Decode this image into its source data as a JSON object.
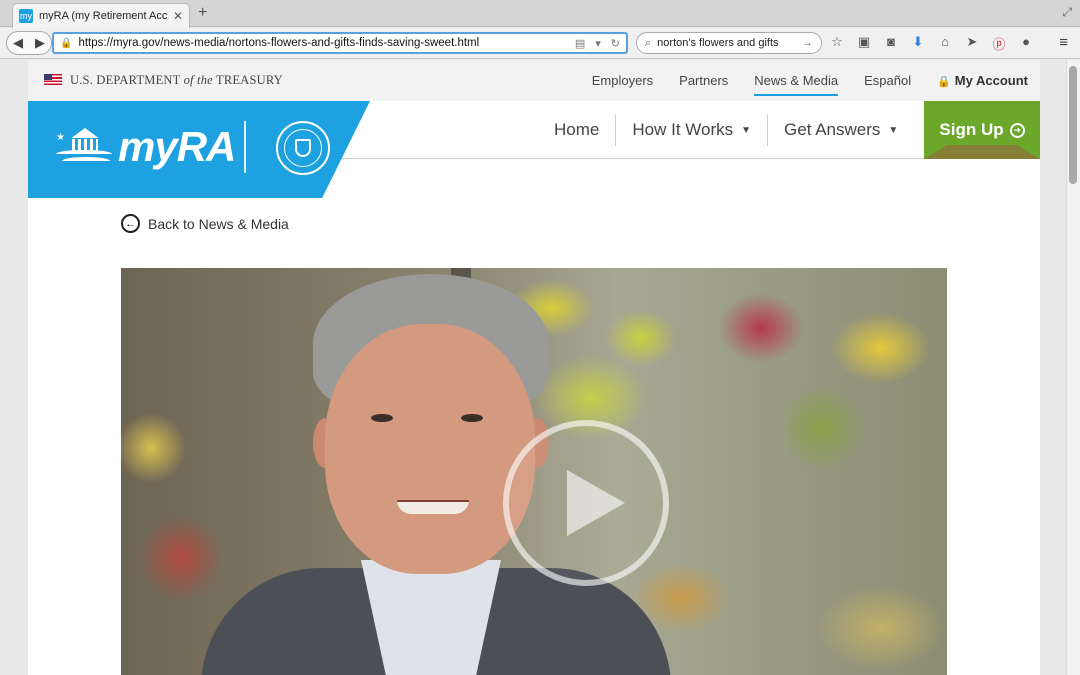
{
  "browser": {
    "tab": {
      "title": "myRA (my Retirement Acc…",
      "favicon_text": "my"
    },
    "url": "https://myra.gov/news-media/nortons-flowers-and-gifts-finds-saving-sweet.html",
    "search_query": "norton's flowers and gifts",
    "icons": [
      "star-icon",
      "reading-list-icon",
      "pocket-icon",
      "download-icon",
      "home-icon",
      "send-icon",
      "pinterest-icon",
      "chat-icon",
      "menu-icon"
    ]
  },
  "gov_bar": {
    "agency_prefix": "U.S. DEPARTMENT ",
    "agency_italic": "of the",
    "agency_suffix": " TREASURY",
    "links": {
      "employers": "Employers",
      "partners": "Partners",
      "news_media": "News & Media",
      "espanol": "Español",
      "my_account": "My Account"
    }
  },
  "brand": {
    "name": "myRA"
  },
  "main_nav": {
    "home": "Home",
    "how_it_works": "How It Works",
    "get_answers": "Get Answers",
    "sign_up": "Sign Up"
  },
  "back_link": "Back to News & Media",
  "colors": {
    "brand_blue": "#1ea1e0",
    "signup_green": "#6ba82a",
    "active_underline": "#1b9de2"
  }
}
